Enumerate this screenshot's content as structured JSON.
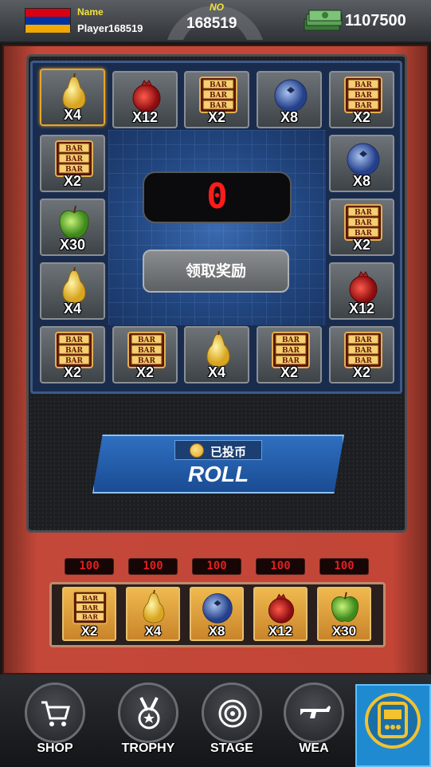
{
  "topbar": {
    "name_label": "Name",
    "player_name": "Player168519",
    "no_label": "NO",
    "no_value": "168519",
    "cash_value": "1107500",
    "flag_colors": [
      "#d90012",
      "#0033a0",
      "#f2a800"
    ]
  },
  "board": {
    "counter_value": "0",
    "claim_button_label": "领取奖励",
    "tiles": [
      {
        "item": "pear",
        "multiplier": "X4",
        "selected": true
      },
      {
        "item": "pomegranate",
        "multiplier": "X12"
      },
      {
        "item": "bar",
        "multiplier": "X2"
      },
      {
        "item": "blueberry",
        "multiplier": "X8"
      },
      {
        "item": "bar",
        "multiplier": "X2"
      },
      {
        "item": "bar",
        "multiplier": "X2"
      },
      {
        "item": "blueberry",
        "multiplier": "X8"
      },
      {
        "item": "apple",
        "multiplier": "X30"
      },
      {
        "item": "bar",
        "multiplier": "X2"
      },
      {
        "item": "pear",
        "multiplier": "X4"
      },
      {
        "item": "pomegranate",
        "multiplier": "X12"
      },
      {
        "item": "bar",
        "multiplier": "X2"
      },
      {
        "item": "bar",
        "multiplier": "X2"
      },
      {
        "item": "pear",
        "multiplier": "X4"
      },
      {
        "item": "bar",
        "multiplier": "X2"
      },
      {
        "item": "bar",
        "multiplier": "X2"
      }
    ]
  },
  "roll": {
    "coin_label": "已投币",
    "label": "ROLL"
  },
  "bets": [
    {
      "amount": "100",
      "item": "bar",
      "multiplier": "X2"
    },
    {
      "amount": "100",
      "item": "pear",
      "multiplier": "X4"
    },
    {
      "amount": "100",
      "item": "blueberry",
      "multiplier": "X8"
    },
    {
      "amount": "100",
      "item": "pomegranate",
      "multiplier": "X12"
    },
    {
      "amount": "100",
      "item": "apple",
      "multiplier": "X30"
    }
  ],
  "nav": {
    "shop": "SHOP",
    "trophy": "TROPHY",
    "stage": "STAGE",
    "weapon": "WEA"
  }
}
